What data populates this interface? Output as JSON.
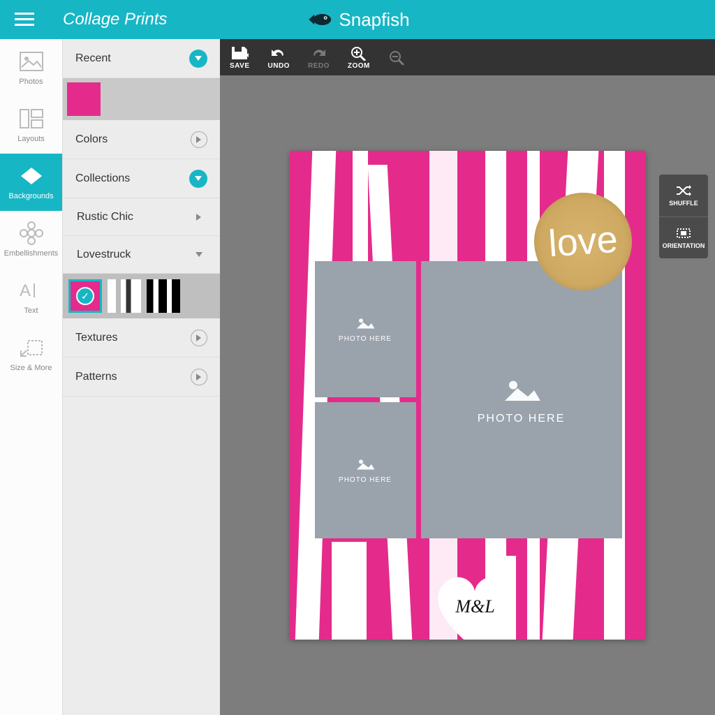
{
  "header": {
    "title": "Collage Prints",
    "brand": "Snapfish"
  },
  "rail": [
    {
      "label": "Photos"
    },
    {
      "label": "Layouts"
    },
    {
      "label": "Backgrounds",
      "active": true
    },
    {
      "label": "Embellishments"
    },
    {
      "label": "Text"
    },
    {
      "label": "Size & More"
    }
  ],
  "panel": {
    "recent": "Recent",
    "colors": "Colors",
    "collections": "Collections",
    "rustic": "Rustic Chic",
    "lovestruck": "Lovestruck",
    "textures": "Textures",
    "patterns": "Patterns"
  },
  "toolbar": {
    "save": "SAVE",
    "undo": "UNDO",
    "redo": "REDO",
    "zoom": "ZOOM"
  },
  "float": {
    "shuffle": "SHUFFLE",
    "orientation": "ORIENTATION"
  },
  "canvas": {
    "photo_here": "PHOTO HERE",
    "love": "love",
    "initials": "M&L"
  }
}
